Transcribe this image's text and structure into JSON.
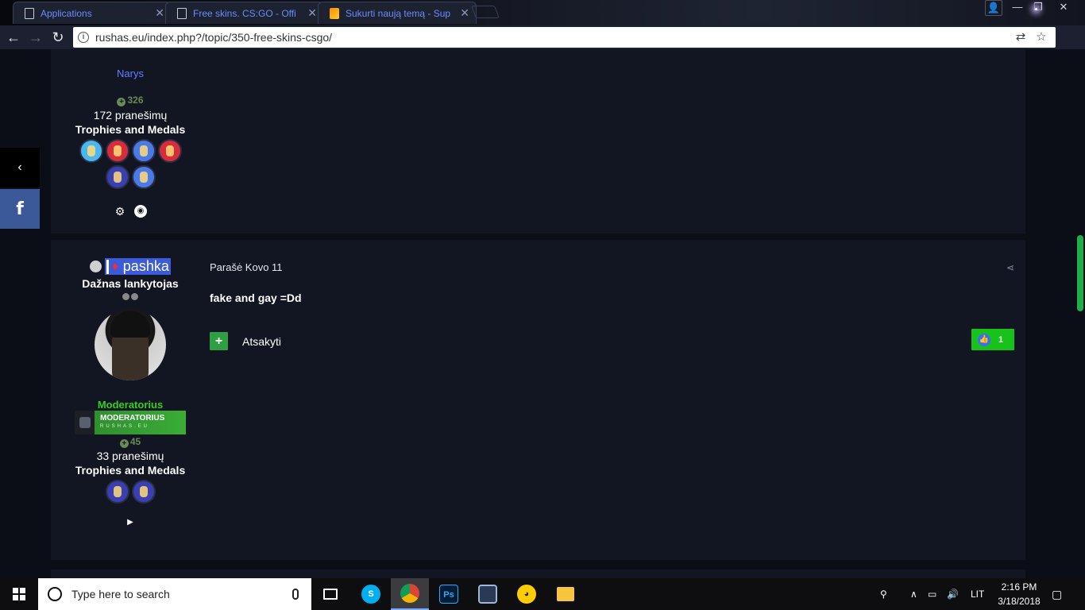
{
  "browser": {
    "tabs": [
      {
        "title": "Applications",
        "icon": "page-icon"
      },
      {
        "title": "Free skins. CS:GO - Offi",
        "icon": "page-icon"
      },
      {
        "title": "Sukurti naują temą - Sup",
        "icon": "flame-icon"
      }
    ],
    "url": "rushas.eu/index.php?/topic/350-free-skins-csgo/"
  },
  "post1": {
    "rank_title": "Narys",
    "reputation": "326",
    "posts_count": "172 pranešimų",
    "trophies_label": "Trophies and Medals",
    "medal_colors": [
      "#49b8f0",
      "#d92b3a",
      "#4a7ae8",
      "#d92b3a",
      "#3b3fb4",
      "#4a7ae8"
    ],
    "social": [
      "steam-icon",
      "snapchat-icon"
    ]
  },
  "post2": {
    "username": "pashka",
    "rank_name": "Dažnas lankytojas",
    "group_name": "Moderatorius",
    "badge_title": "MODERATORIUS",
    "badge_sub": "RUSHAS.EU",
    "reputation": "45",
    "posts_count": "33 pranešimų",
    "trophies_label": "Trophies and Medals",
    "medal_colors": [
      "#3b3fb4",
      "#3b3fb4"
    ],
    "social": [
      "youtube-icon"
    ],
    "meta": "Parašė Kovo 11",
    "body": "fake and gay =Dd",
    "reply_label": "Atsakyti",
    "like_count": "1"
  },
  "taskbar": {
    "search_placeholder": "Type here to search",
    "language": "LIT",
    "time": "2:16 PM",
    "date": "3/18/2018"
  }
}
